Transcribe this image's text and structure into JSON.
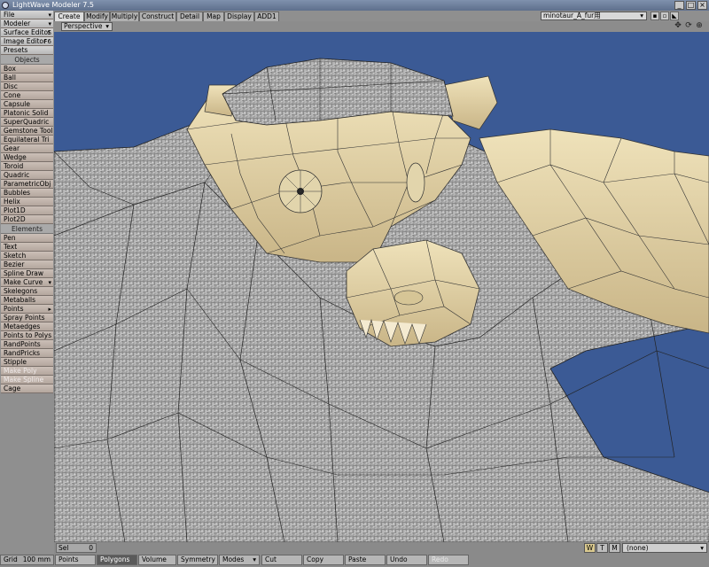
{
  "window": {
    "title": "LightWave Modeler 7.5",
    "buttons": [
      "_",
      "□",
      "×"
    ]
  },
  "left_panel": {
    "top_buttons": [
      {
        "label": "File",
        "arrow": "▾"
      },
      {
        "label": "Modeler",
        "arrow": "▾"
      },
      {
        "label": "Surface Editor",
        "arrow": "S"
      },
      {
        "label": "Image Editor",
        "arrow": "F6"
      },
      {
        "label": "Presets",
        "arrow": ""
      }
    ],
    "objects_header": "Objects",
    "objects": [
      "Box",
      "Ball",
      "Disc",
      "Cone",
      "Capsule",
      "Platonic Solid",
      "SuperQuadric",
      "Gemstone Tool",
      "Equilateral Tri",
      "Gear",
      "Wedge",
      "Toroid",
      "Quadric",
      "ParametricObj",
      "Bubbles",
      "Helix",
      "Plot1D",
      "Plot2D"
    ],
    "elements_header": "Elements",
    "elements": [
      {
        "label": "Pen",
        "arrow": ""
      },
      {
        "label": "Text",
        "arrow": ""
      },
      {
        "label": "Sketch",
        "arrow": ""
      },
      {
        "label": "Bezier",
        "arrow": ""
      },
      {
        "label": "Spline Draw",
        "arrow": ""
      },
      {
        "label": "Make Curve",
        "arrow": "▾"
      },
      {
        "label": "Skelegons",
        "arrow": ""
      },
      {
        "label": "Metaballs",
        "arrow": ""
      },
      {
        "label": "Points",
        "arrow": "▸"
      },
      {
        "label": "Spray Points",
        "arrow": ""
      },
      {
        "label": "Metaedges",
        "arrow": ""
      },
      {
        "label": "Points to Polys",
        "arrow": ""
      },
      {
        "label": "RandPoints",
        "arrow": ""
      },
      {
        "label": "RandPricks",
        "arrow": ""
      },
      {
        "label": "Stipple",
        "arrow": ""
      },
      {
        "label": "Make Poly",
        "arrow": "",
        "disabled": true
      },
      {
        "label": "Make Spline",
        "arrow": "",
        "disabled": true
      },
      {
        "label": "Cage",
        "arrow": ""
      }
    ]
  },
  "tabs": [
    {
      "label": "Create",
      "active": true
    },
    {
      "label": "Modify"
    },
    {
      "label": "Multiply"
    },
    {
      "label": "Construct"
    },
    {
      "label": "Detail"
    },
    {
      "label": "Map"
    },
    {
      "label": "Display"
    },
    {
      "label": "ADD1"
    }
  ],
  "object_selector": {
    "value": "minotaur_A_fur用",
    "arrow": "▾"
  },
  "viewport": {
    "view_mode": "Perspective",
    "arrow": "▾",
    "background_color": "#3b5a95",
    "icons": [
      "✥",
      "⟳",
      "⊕"
    ]
  },
  "status_bar": {
    "sel_label": "Sel",
    "sel_value": "0",
    "wtm": [
      {
        "label": "W",
        "on": true
      },
      {
        "label": "T"
      },
      {
        "label": "M"
      }
    ],
    "layer_select": "(none)",
    "layer_arrow": "▾"
  },
  "bottom_bar": {
    "grid_label": "Grid",
    "grid_value": "100 mm",
    "buttons": [
      {
        "label": "Points"
      },
      {
        "label": "Polygons",
        "on": true
      },
      {
        "label": "Volume"
      },
      {
        "label": "Symmetry"
      },
      {
        "label": "Modes",
        "arrow": "▾"
      },
      {
        "label": "Cut"
      },
      {
        "label": "Copy"
      },
      {
        "label": "Paste"
      },
      {
        "label": "Undo"
      },
      {
        "label": "Redo",
        "disabled": true
      }
    ]
  }
}
